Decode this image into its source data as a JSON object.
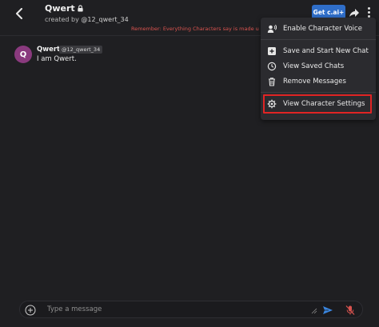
{
  "header": {
    "title": "Qwert",
    "created_by_prefix": "created by ",
    "creator": "@12_qwert_34",
    "notice": "Remember: Everything Characters say is made up!",
    "get_button": "Get c.ai+"
  },
  "message": {
    "avatar_letter": "Q",
    "author": "Qwert",
    "author_tag": "@12_qwert_34",
    "text": "I am Qwert."
  },
  "menu": {
    "items": [
      {
        "label": "Enable Character Voice",
        "icon": "voice-icon"
      },
      {
        "label": "Save and Start New Chat",
        "icon": "new-chat-icon"
      },
      {
        "label": "View Saved Chats",
        "icon": "history-icon"
      },
      {
        "label": "Remove Messages",
        "icon": "trash-icon"
      },
      {
        "label": "View Character Settings",
        "icon": "gear-icon"
      }
    ]
  },
  "composer": {
    "placeholder": "Type a message"
  },
  "colors": {
    "background": "#1f1f22",
    "accent": "#2f6ec9",
    "notice": "#d9534f",
    "highlight": "#e02424",
    "avatar": "#8a3a7e"
  }
}
